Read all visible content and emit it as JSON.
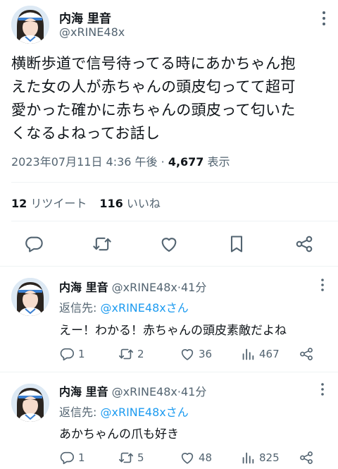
{
  "tweet": {
    "author_name": "内海 里音",
    "author_handle": "@xRINE48x",
    "text_lines": [
      "横断歩道で信号待ってる時にあかちゃん抱",
      "えた女の人が赤ちゃんの頭皮匂ってて超可",
      "愛かった確かに赤ちゃんの頭皮って匂いた",
      "くなるよねってお話し"
    ],
    "timestamp": "2023年07月11日 4:36 午後",
    "separator": "·",
    "views_count": "4,677",
    "views_label": "表示",
    "retweets_count": "12",
    "retweets_label": "リツイート",
    "likes_count": "116",
    "likes_label": "いいね",
    "actions": [
      "reply-icon",
      "retweet-icon",
      "like-icon",
      "bookmark-icon",
      "share-icon"
    ]
  },
  "replies": [
    {
      "author_name": "内海 里音",
      "author_handle": "@xRINE48x",
      "time": "41分",
      "reply_to_label": "返信先:",
      "reply_to_handle": "@xRINE48xさん",
      "text": "えー！わかる！赤ちゃんの頭皮素敵だよね",
      "replies": "1",
      "retweets": "2",
      "likes": "36",
      "views": "467"
    },
    {
      "author_name": "内海 里音",
      "author_handle": "@xRINE48x",
      "time": "41分",
      "reply_to_label": "返信先:",
      "reply_to_handle": "@xRINE48xさん",
      "text": "あかちゃんの爪も好き",
      "replies": "1",
      "retweets": "5",
      "likes": "48",
      "views": "825"
    }
  ],
  "colors": {
    "text": "#0f1419",
    "muted": "#536471",
    "link": "#1d9bf0",
    "divider": "#eff3f4"
  }
}
